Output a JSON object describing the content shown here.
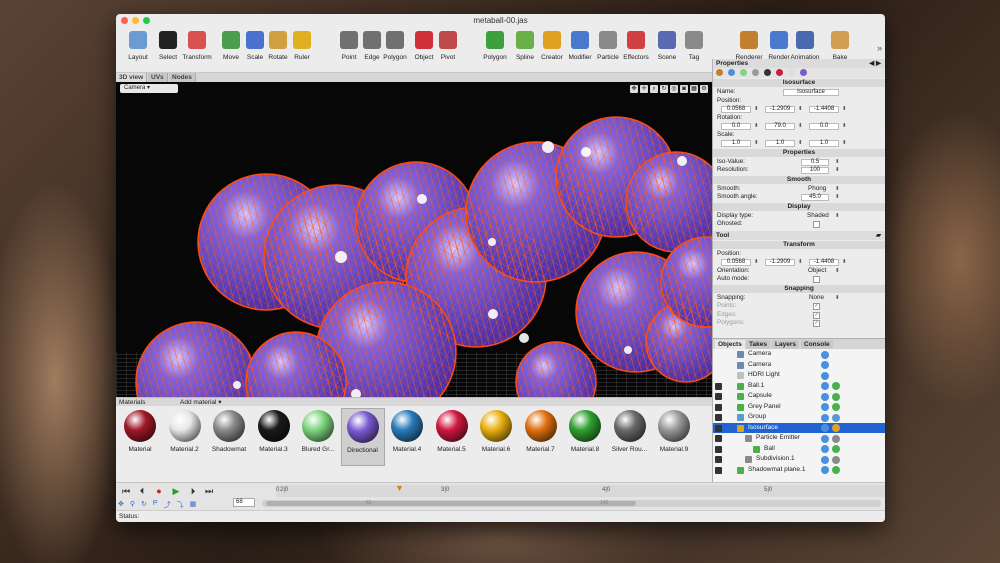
{
  "window": {
    "title": "metaball-00.jas"
  },
  "toolbar": [
    {
      "label": "Layout",
      "icon": "layout-icon",
      "color": "#6b9bd1"
    },
    {
      "label": "Select",
      "icon": "cursor-icon",
      "color": "#222222"
    },
    {
      "label": "Transform",
      "icon": "transform-icon",
      "color": "#d95050"
    },
    {
      "label": "Move",
      "icon": "move-icon",
      "color": "#4a9d4a"
    },
    {
      "label": "Scale",
      "icon": "scale-icon",
      "color": "#4a70d0"
    },
    {
      "label": "Rotate",
      "icon": "rotate-icon",
      "color": "#d0a040"
    },
    {
      "label": "Ruler",
      "icon": "ruler-icon",
      "color": "#e0b020"
    },
    {
      "label": "Point",
      "icon": "point-icon",
      "color": "#707070"
    },
    {
      "label": "Edge",
      "icon": "edge-icon",
      "color": "#707070"
    },
    {
      "label": "Polygon",
      "icon": "polygon-mode-icon",
      "color": "#707070"
    },
    {
      "label": "Object",
      "icon": "object-icon",
      "color": "#d0303a"
    },
    {
      "label": "Pivot",
      "icon": "pivot-icon",
      "color": "#c04a4a"
    },
    {
      "label": "Polygon",
      "icon": "cube-icon",
      "color": "#3ca03c"
    },
    {
      "label": "Spline",
      "icon": "spline-icon",
      "color": "#6ab04a"
    },
    {
      "label": "Creator",
      "icon": "creator-icon",
      "color": "#e0a020"
    },
    {
      "label": "Modifier",
      "icon": "modifier-icon",
      "color": "#4a7ad0"
    },
    {
      "label": "Particle",
      "icon": "particle-icon",
      "color": "#8a8a8a"
    },
    {
      "label": "Effectors",
      "icon": "effectors-icon",
      "color": "#d04040"
    },
    {
      "label": "Scene",
      "icon": "scene-icon",
      "color": "#5a6ab0"
    },
    {
      "label": "Tag",
      "icon": "tag-icon",
      "color": "#8a8a8a"
    },
    {
      "label": "Renderer",
      "icon": "renderer-icon",
      "color": "#c08030"
    },
    {
      "label": "Render",
      "icon": "render-camera-icon",
      "color": "#4a7ad0"
    },
    {
      "label": "Animation",
      "icon": "animation-icon",
      "color": "#4a6ab0"
    },
    {
      "label": "Bake",
      "icon": "bake-icon",
      "color": "#d0a050"
    }
  ],
  "viewtabs": [
    "3D view",
    "UVs",
    "Nodes"
  ],
  "viewport": {
    "camera": "Camera"
  },
  "materials": {
    "header": "Materials",
    "add": "Add material",
    "items": [
      {
        "name": "Material",
        "color": "#a01828"
      },
      {
        "name": "Material.2",
        "color": "#e8e8e8"
      },
      {
        "name": "Shadowmat",
        "color": "#8a8a8a"
      },
      {
        "name": "Material.3",
        "color": "#1a1a1a"
      },
      {
        "name": "Blured Gr...",
        "color": "#7ed67e"
      },
      {
        "name": "Directional",
        "color": "#7a5ad0"
      },
      {
        "name": "Material.4",
        "color": "#2a7ab8"
      },
      {
        "name": "Material.5",
        "color": "#d01840"
      },
      {
        "name": "Material.6",
        "color": "#e8b010"
      },
      {
        "name": "Material.7",
        "color": "#e07010"
      },
      {
        "name": "Material.8",
        "color": "#30a030"
      },
      {
        "name": "Silver Rou...",
        "color": "#6a6a6a"
      },
      {
        "name": "Material.9",
        "color": "#9a9a9a"
      }
    ],
    "selected": "Directional"
  },
  "properties": {
    "header": "Properties",
    "section": "Isosurface",
    "name_label": "Name:",
    "name_value": "Isosurface",
    "position_label": "Position:",
    "position": [
      "0.0568",
      "-1.2909",
      "-1.4408"
    ],
    "rotation_label": "Rotation:",
    "rotation": [
      "0.0",
      "79.0",
      "0.0"
    ],
    "scale_label": "Scale:",
    "scale": [
      "1.0",
      "1.0",
      "1.0"
    ],
    "props_section": "Properties",
    "iso_label": "Iso-Value:",
    "iso_value": "0.5",
    "res_label": "Resolution:",
    "res_value": "100",
    "smooth_section": "Smooth",
    "smooth_label": "Smooth:",
    "smooth_value": "Phong",
    "angle_label": "Smooth angle:",
    "angle_value": "45.0",
    "display_section": "Display",
    "dtype_label": "Display type:",
    "dtype_value": "Shaded",
    "ghosted_label": "Ghosted:"
  },
  "tool": {
    "header": "Tool",
    "section": "Transform",
    "position_label": "Position:",
    "position": [
      "0.0568",
      "-1.2909",
      "-1.4408"
    ],
    "orient_label": "Orientation:",
    "orient_value": "Object",
    "auto_label": "Auto mode:",
    "snap_section": "Snapping",
    "snapping_label": "Snapping:",
    "snapping_value": "None",
    "points_label": "Points:",
    "edges_label": "Edges:",
    "polygons_label": "Polygons:"
  },
  "objects": {
    "tabs": [
      "Objects",
      "Takes",
      "Layers",
      "Console"
    ],
    "items": [
      {
        "name": "Camera",
        "indent": 0,
        "icon": "#6a8ab0"
      },
      {
        "name": "Camera",
        "indent": 0,
        "icon": "#6a8ab0"
      },
      {
        "name": "HDRI Light",
        "indent": 0,
        "icon": "#c0c0c0"
      },
      {
        "name": "Ball.1",
        "indent": 0,
        "icon": "#4ab04a"
      },
      {
        "name": "Capsule",
        "indent": 0,
        "icon": "#4ab04a"
      },
      {
        "name": "Grey Panel",
        "indent": 0,
        "icon": "#4ab04a"
      },
      {
        "name": "Group",
        "indent": 0,
        "icon": "#5a9ad0"
      },
      {
        "name": "Isosurface",
        "indent": 0,
        "icon": "#e0a020",
        "selected": true
      },
      {
        "name": "Particle Emitter",
        "indent": 1,
        "icon": "#8a8a8a"
      },
      {
        "name": "Ball",
        "indent": 2,
        "icon": "#4ab04a"
      },
      {
        "name": "Subdivision.1",
        "indent": 1,
        "icon": "#8a8a8a"
      },
      {
        "name": "Shadowmat plane.1",
        "indent": 0,
        "icon": "#4ab04a"
      }
    ]
  },
  "timeline": {
    "ticks": [
      "0",
      "2|0",
      "3|0",
      "4|0",
      "5|0"
    ],
    "frame": "68",
    "range_start": "62",
    "range_end": "142"
  },
  "status": {
    "label": "Status:"
  }
}
